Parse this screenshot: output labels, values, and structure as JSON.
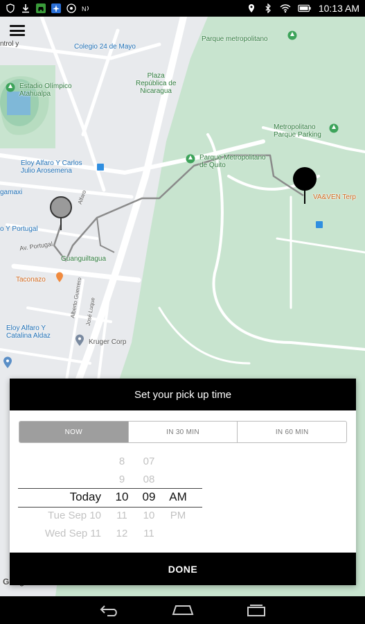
{
  "status_bar": {
    "time": "10:13 AM",
    "left_icons": [
      "shield-icon",
      "download-icon",
      "car-icon",
      "airplane-icon",
      "location-circle-icon",
      "nfc-icon"
    ],
    "right_icons": [
      "location-icon",
      "bluetooth-icon",
      "wifi-icon",
      "battery-icon"
    ]
  },
  "map": {
    "labels": {
      "parque_metropolitano": "Parque metropolitano",
      "colegio": "Colegio 24 de Mayo",
      "plaza": "Plaza\nRepública de\nNicaragua",
      "estadio": "Estadio Olímpico\nAtahualpa",
      "metro_parking": "Metropolitano\nParque Parking",
      "parque_quito": "Parque Metropolitano\nde Quito",
      "eloy_arosemena": "Eloy Alfaro Y Carlos\nJulio Arosemena",
      "gamaxi": "gamaxi",
      "portugal": "o Y Portugal",
      "av_portugal": "Av. Portugal",
      "guanguiltagua": "Guanguiltagua",
      "taconazo": "Taconazo",
      "vaven": "VA&VEN Terp",
      "eloy_aldaz": "Eloy Alfaro Y\nCatalina Aldaz",
      "kruger": "Kruger Corp",
      "control": "ntrol y",
      "alfaro": "Alfaro",
      "alberto": "Alberto Guerrero",
      "jose_luque": "José Luque",
      "google": "Google"
    },
    "brand_colors": {
      "park": "#c6e3cd",
      "route": "#8a8a8a"
    }
  },
  "menu_icon": "hamburger-menu-icon",
  "dialog": {
    "title": "Set your pick up time",
    "tabs": [
      {
        "label": "NOW",
        "active": true
      },
      {
        "label": "IN 30 MIN",
        "active": false
      },
      {
        "label": "IN 60 MIN",
        "active": false
      }
    ],
    "picker": {
      "day": [
        "",
        "",
        "Today",
        "Tue Sep 10",
        "Wed Sep 11"
      ],
      "hour": [
        "8",
        "9",
        "10",
        "11",
        "12"
      ],
      "minute": [
        "07",
        "08",
        "09",
        "10",
        "11"
      ],
      "ampm": [
        "",
        "",
        "AM",
        "PM",
        ""
      ]
    },
    "done_label": "DONE"
  },
  "nav_bar": {
    "icons": [
      "back-icon",
      "home-icon",
      "recents-icon"
    ]
  }
}
